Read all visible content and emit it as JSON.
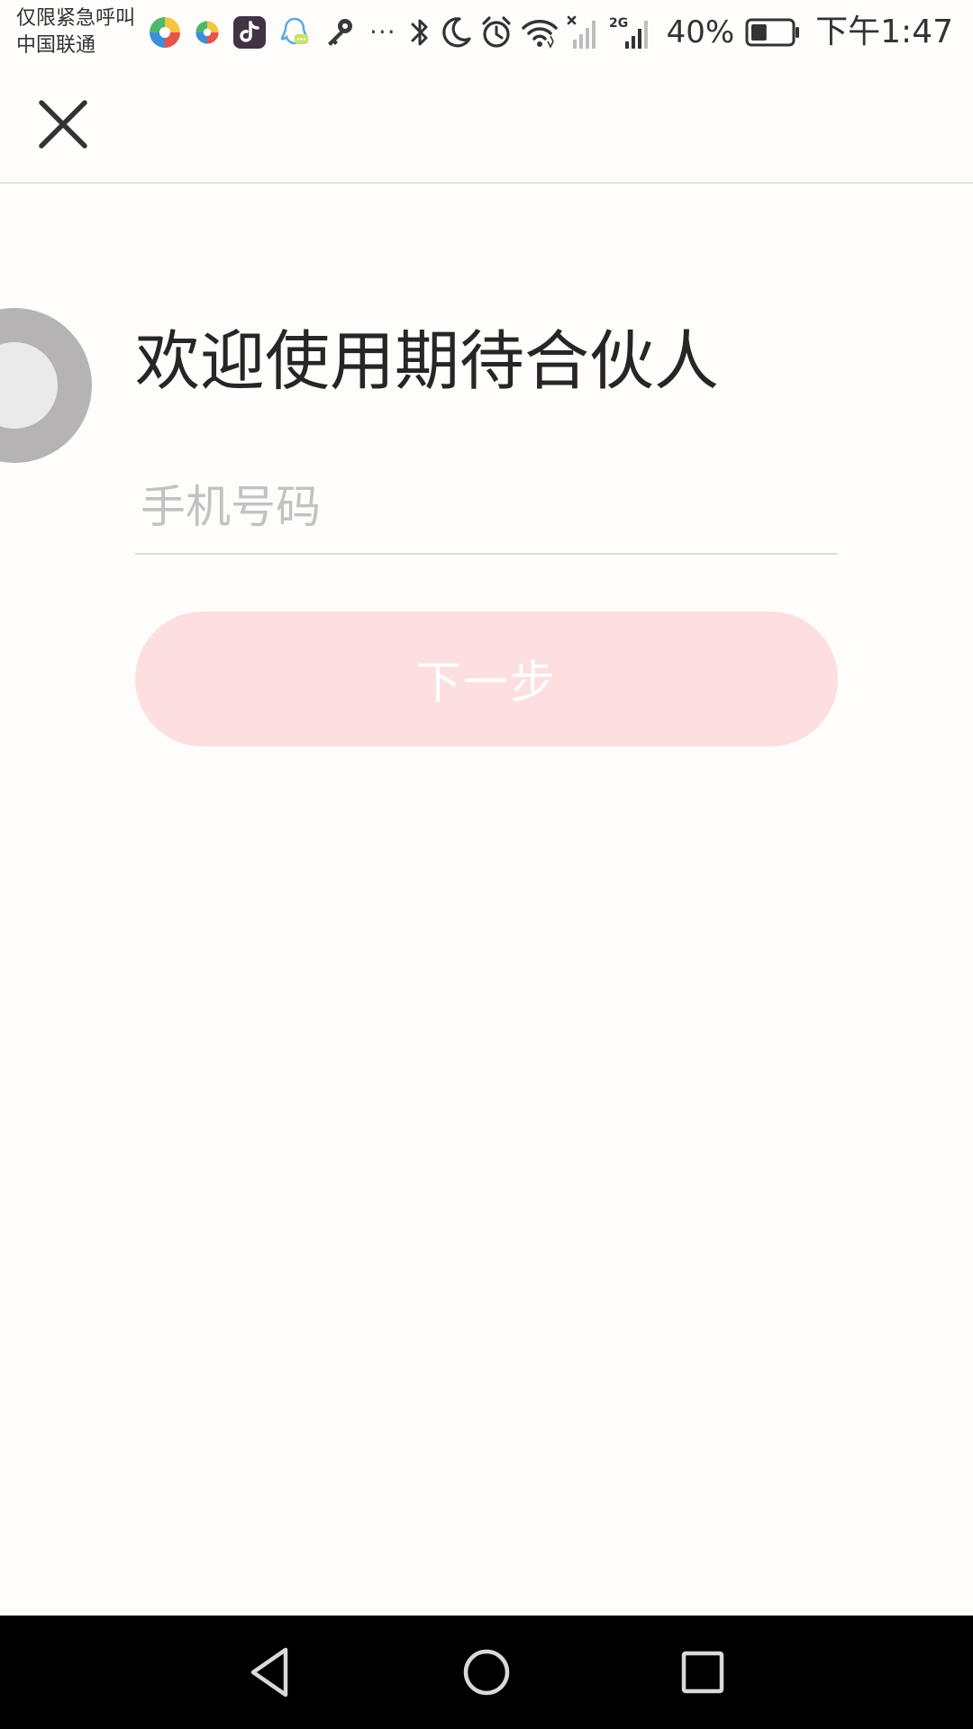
{
  "status_bar": {
    "carrier_line1": "仅限紧急呼叫",
    "carrier_line2": "中国联通",
    "more_indicator": "···",
    "network_type": "2G",
    "battery_percent": "40%",
    "battery_level": 0.4,
    "time": "下午1:47",
    "notification_icons": [
      "colorful-ball-app-icon",
      "colorful-ball-small-app-icon",
      "tiktok-icon",
      "qq-icon",
      "key-icon"
    ],
    "system_icons": [
      "bluetooth-icon",
      "moon-icon",
      "alarm-icon",
      "wifi-icon",
      "signal-icon-no-sim",
      "signal-icon-2g"
    ]
  },
  "header": {
    "close_icon": "close-icon"
  },
  "main": {
    "title": "欢迎使用期待合伙人",
    "phone_placeholder": "手机号码",
    "phone_value": "",
    "next_label": "下一步"
  },
  "colors": {
    "background": "#fffdfc",
    "button_disabled": "#fddfdf",
    "button_text": "#ffffff",
    "title_text": "#262626",
    "placeholder_text": "#c2c2c2",
    "deco_ring": "#b5b3b4"
  },
  "nav_bar": {
    "icons": [
      "back-icon",
      "home-icon",
      "recent-apps-icon"
    ]
  }
}
